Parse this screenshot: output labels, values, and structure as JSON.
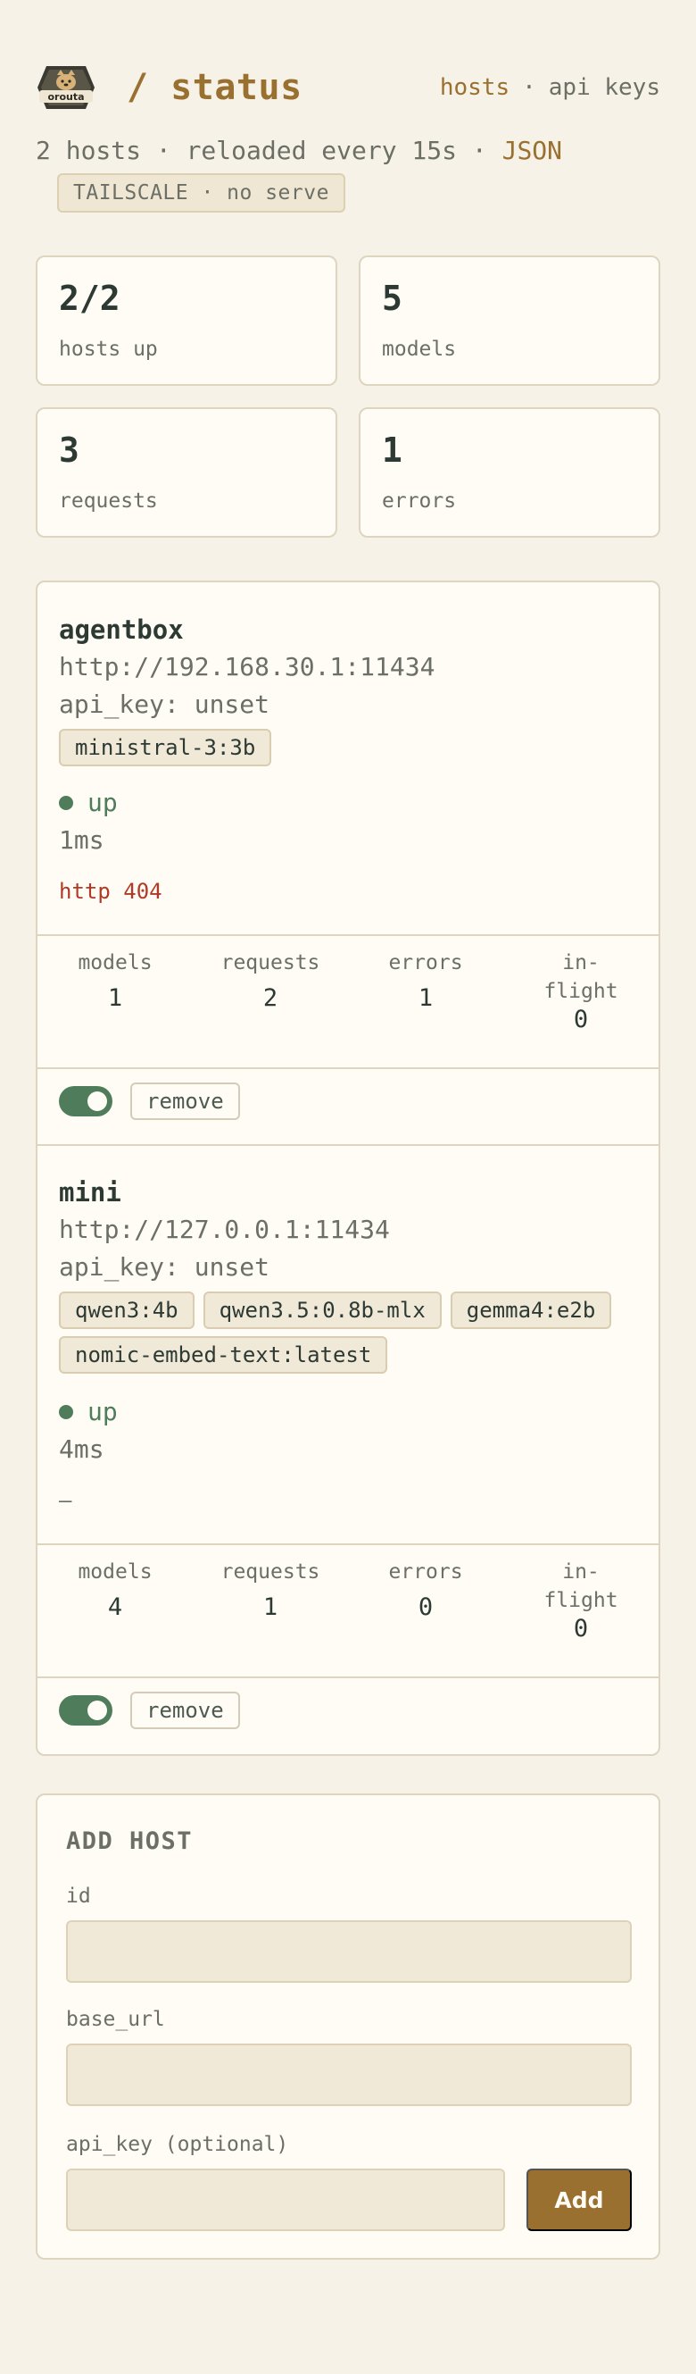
{
  "header": {
    "logo_text": "orouta",
    "title": "/ status",
    "nav": [
      {
        "label": "hosts"
      },
      {
        "label": "·"
      },
      {
        "label": "api keys"
      }
    ]
  },
  "subline": {
    "text": "2 hosts · reloaded every 15s · ",
    "json_link": "JSON",
    "badge": "TAILSCALE · no serve"
  },
  "stats": [
    {
      "value": "2/2",
      "label": "hosts up"
    },
    {
      "value": "5",
      "label": "models"
    },
    {
      "value": "3",
      "label": "requests"
    },
    {
      "value": "1",
      "label": "errors"
    }
  ],
  "hosts": [
    {
      "name": "agentbox",
      "url": "http://192.168.30.1:11434",
      "api_key": "api_key: unset",
      "models": [
        "ministral-3:3b"
      ],
      "status": "up",
      "latency": "1ms",
      "last_error": "http 404",
      "metrics": [
        {
          "label": "models",
          "value": "1"
        },
        {
          "label": "requests",
          "value": "2"
        },
        {
          "label": "errors",
          "value": "1"
        },
        {
          "label": "in-\nflight",
          "value": "0"
        }
      ],
      "enabled": true,
      "remove_label": "remove"
    },
    {
      "name": "mini",
      "url": "http://127.0.0.1:11434",
      "api_key": "api_key: unset",
      "models": [
        "qwen3:4b",
        "qwen3.5:0.8b-mlx",
        "gemma4:e2b",
        "nomic-embed-text:latest"
      ],
      "status": "up",
      "latency": "4ms",
      "last_error": "—",
      "metrics": [
        {
          "label": "models",
          "value": "4"
        },
        {
          "label": "requests",
          "value": "1"
        },
        {
          "label": "errors",
          "value": "0"
        },
        {
          "label": "in-\nflight",
          "value": "0"
        }
      ],
      "enabled": true,
      "remove_label": "remove"
    }
  ],
  "add_host": {
    "title": "ADD HOST",
    "id_label": "id",
    "id_value": "",
    "base_url_label": "base_url",
    "base_url_value": "",
    "api_key_label": "api_key (optional)",
    "api_key_value": "",
    "add_label": "Add"
  },
  "colors": {
    "accent": "#9a7030",
    "status_up": "#4f7d5c",
    "error": "#b03a26",
    "background": "#f6f2e8"
  }
}
